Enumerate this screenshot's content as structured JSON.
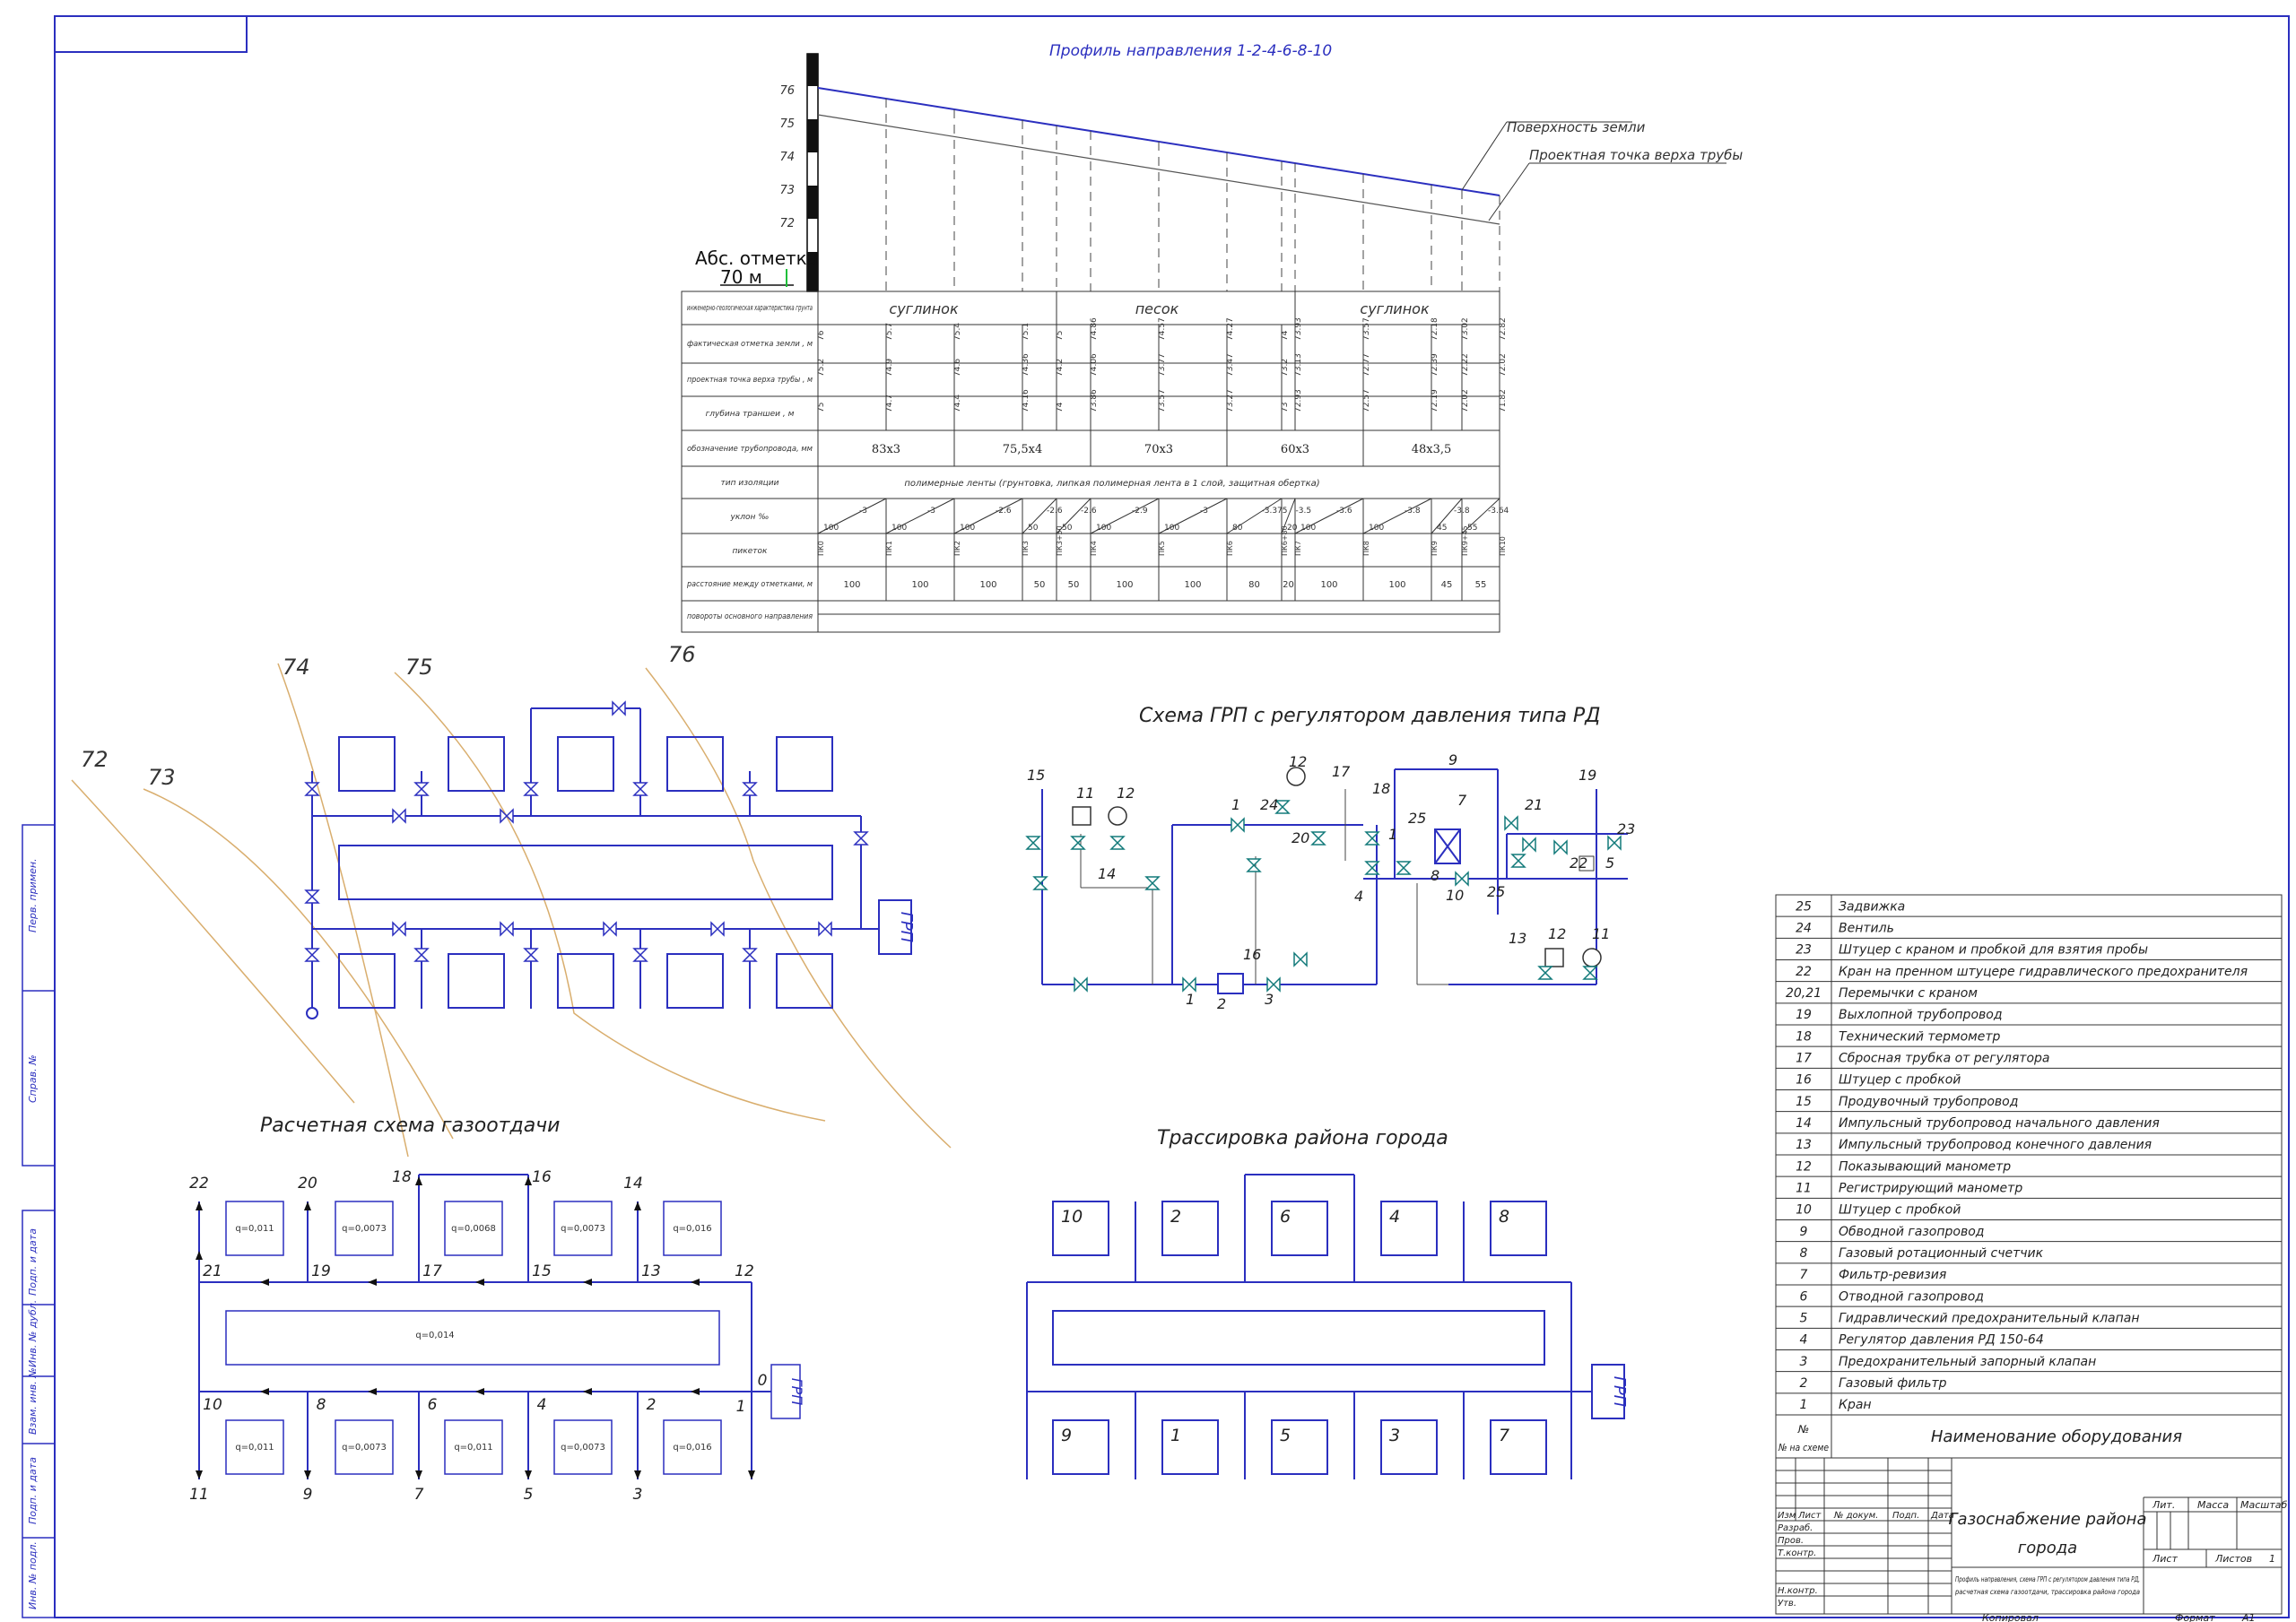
{
  "profile": {
    "title": "Профиль направления 1-2-4-6-8-10",
    "elev_ticks": [
      "76",
      "75",
      "74",
      "73",
      "72"
    ],
    "abs_label": "Абс. отметка",
    "abs_value": "70 м",
    "legend_ground": "Поверхность земли",
    "legend_pipe": "Проектная точка верха трубы",
    "rows": [
      "инженерно-геологическая характеристика грунта",
      "фактическая отметка земли , м",
      "проектная точка верха трубы , м",
      "глубина траншеи , м",
      "обозначение трубопровода, мм",
      "тип изоляции",
      "уклон ‰",
      "пикеток",
      "расстояние между отметками, м",
      "повороты основного направления"
    ],
    "soils": [
      "суглинок",
      "песок",
      "суглинок"
    ],
    "ground_elev": [
      "76",
      "75.7",
      "75.4",
      "75.1",
      "75",
      "74.86",
      "74.57",
      "74.27",
      "74",
      "73.93",
      "73.57",
      "72.18",
      "73.02",
      "72.82"
    ],
    "pipe_elev": [
      "75.2",
      "74.9",
      "74.6",
      "74.36",
      "74.2",
      "74.06",
      "73.77",
      "73.47",
      "73.2",
      "73.13",
      "72.77",
      "72.39",
      "72.22",
      "72.02"
    ],
    "depth": [
      "75",
      "74.7",
      "74.4",
      "74.16",
      "74",
      "73.86",
      "73.57",
      "73.27",
      "73",
      "72.93",
      "72.57",
      "72.19",
      "72.02",
      "71.82"
    ],
    "pipes": [
      "83х3",
      "75,5х4",
      "70х3",
      "60х3",
      "48х3,5"
    ],
    "insulation": "полимерные ленты (грунтовка, липкая полимерная лента в 1 слой, защитная обертка)",
    "slopes": [
      "-3",
      "-3",
      "-2.6",
      "-2.6",
      "-2.6",
      "-2.9",
      "-3",
      "-3.375",
      "-3.5",
      "-3.6",
      "-3.8",
      "-3.8",
      "-3.64"
    ],
    "slope_lengths": [
      "100",
      "100",
      "100",
      "50",
      "50",
      "100",
      "100",
      "80",
      "20",
      "100",
      "100",
      "45",
      "55"
    ],
    "pickets": [
      "ПК0",
      "ПК1",
      "ПК2",
      "ПК3",
      "ПК3+50",
      "ПК4",
      "ПК5",
      "ПК6",
      "ПК6+80",
      "ПК7",
      "ПК8",
      "ПК9",
      "ПК9+45",
      "ПК10"
    ],
    "distances": [
      "100",
      "100",
      "100",
      "50",
      "50",
      "100",
      "100",
      "80",
      "20",
      "100",
      "100",
      "45",
      "55"
    ]
  },
  "gas_scheme": {
    "contours": [
      "72",
      "73",
      "74",
      "75",
      "76"
    ],
    "grp": "ГРП"
  },
  "calc_scheme": {
    "title": "Расчетная схема газоотдачи",
    "q_top": [
      "q=0,011",
      "q=0,0073",
      "q=0,0068",
      "q=0,0073",
      "q=0,016"
    ],
    "q_center": "q=0,014",
    "q_bottom": [
      "q=0,011",
      "q=0,0073",
      "q=0,011",
      "q=0,0073",
      "q=0,016"
    ],
    "top_end_nodes": [
      "22",
      "20",
      "18",
      "16",
      "14"
    ],
    "top_nodes": [
      "21",
      "19",
      "17",
      "15",
      "13",
      "12"
    ],
    "bottom_nodes": [
      "10",
      "8",
      "6",
      "4",
      "2",
      "1"
    ],
    "bottom_end_nodes": [
      "11",
      "9",
      "7",
      "5",
      "3"
    ],
    "zero_node": "0",
    "grp": "ГРП"
  },
  "grp_scheme": {
    "title": "Схема ГРП с регулятором давления типа РД",
    "labels": [
      "15",
      "11",
      "12",
      "1",
      "24",
      "12",
      "17",
      "18",
      "9",
      "19",
      "21",
      "23",
      "20",
      "1",
      "25",
      "7",
      "8",
      "10",
      "25",
      "22",
      "5",
      "14",
      "4",
      "16",
      "1",
      "2",
      "3",
      "13",
      "12",
      "11"
    ]
  },
  "trace": {
    "title": "Трассировка района города",
    "top_blocks": [
      "10",
      "2",
      "6",
      "4",
      "8"
    ],
    "bottom_blocks": [
      "9",
      "1",
      "5",
      "3",
      "7"
    ],
    "grp": "ГРП"
  },
  "equipment": {
    "header_no": "№ на схеме",
    "header_name": "Наименование оборудования",
    "items": [
      {
        "no": "25",
        "name": "Задвижка"
      },
      {
        "no": "24",
        "name": "Вентиль"
      },
      {
        "no": "23",
        "name": "Штуцер с краном и пробкой для взятия пробы"
      },
      {
        "no": "22",
        "name": "Кран на пренном штуцере гидравлического предохранителя"
      },
      {
        "no": "20,21",
        "name": "Перемычки с краном"
      },
      {
        "no": "19",
        "name": "Выхлопной трубопровод"
      },
      {
        "no": "18",
        "name": "Технический термометр"
      },
      {
        "no": "17",
        "name": "Сбросная трубка от регулятора"
      },
      {
        "no": "16",
        "name": "Штуцер с пробкой"
      },
      {
        "no": "15",
        "name": "Продувочный трубопровод"
      },
      {
        "no": "14",
        "name": "Импульсный трубопровод начального давления"
      },
      {
        "no": "13",
        "name": "Импульсный трубопровод конечного давления"
      },
      {
        "no": "12",
        "name": "Показывающий манометр"
      },
      {
        "no": "11",
        "name": "Регистрирующий манометр"
      },
      {
        "no": "10",
        "name": "Штуцер с пробкой"
      },
      {
        "no": "9",
        "name": "Обводной газопровод"
      },
      {
        "no": "8",
        "name": "Газовый ротационный счетчик"
      },
      {
        "no": "7",
        "name": "Фильтр-ревизия"
      },
      {
        "no": "6",
        "name": "Отводной газопровод"
      },
      {
        "no": "5",
        "name": "Гидравлический предохранительный клапан"
      },
      {
        "no": "4",
        "name": "Регулятор давления РД 150-64"
      },
      {
        "no": "3",
        "name": "Предохранительный запорный клапан"
      },
      {
        "no": "2",
        "name": "Газовый фильтр"
      },
      {
        "no": "1",
        "name": "Кран"
      }
    ]
  },
  "title_block": {
    "title_line1": "Газоснабжение района",
    "title_line2": "города",
    "cols": [
      "Изм",
      "Лист",
      "№ докум.",
      "Подп.",
      "Дата"
    ],
    "roles": [
      "Разраб.",
      "Пров.",
      "Т.контр.",
      "Н.контр.",
      "Утв."
    ],
    "lit": "Лит.",
    "mass": "Масса",
    "scale": "Масштаб",
    "sheet": "Лист",
    "sheets": "Листов",
    "sheets_count": "1",
    "desc_line1": "Профиль направления, схема ГРП с регулятором давления типа РД,",
    "desc_line2": "расчетная схема газоотдачи, трассировка района города",
    "copied": "Копировал",
    "format": "Формат",
    "format_value": "А1"
  },
  "side_stamps": [
    "Перв. примен.",
    "Справ. №",
    "Подп. и дата",
    "Инв. № дубл.",
    "Взам. инв. №",
    "Подп. и дата",
    "Инв. № подл."
  ]
}
